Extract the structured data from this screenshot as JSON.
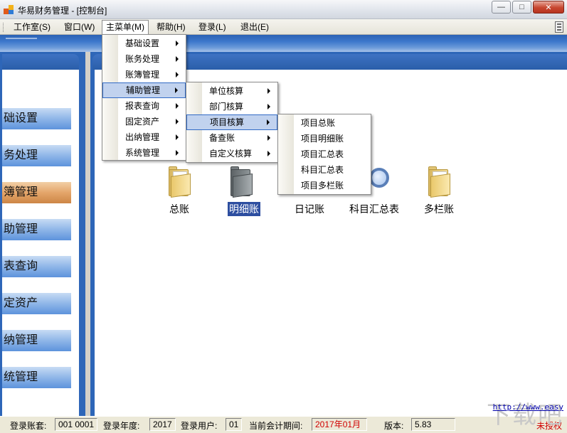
{
  "window": {
    "title": "华易财务管理 - [控制台]",
    "buttons": {
      "minimize": "—",
      "maximize": "□",
      "close": "✕"
    }
  },
  "menubar": {
    "items": [
      {
        "label": "工作室(S)"
      },
      {
        "label": "窗口(W)"
      },
      {
        "label": "主菜单(M)"
      },
      {
        "label": "帮助(H)"
      },
      {
        "label": "登录(L)"
      },
      {
        "label": "退出(E)"
      }
    ],
    "active": "主菜单(M)"
  },
  "menus": {
    "main": [
      "基础设置",
      "账务处理",
      "账簿管理",
      "辅助管理",
      "报表查询",
      "固定资产",
      "出纳管理",
      "系统管理"
    ],
    "main_highlighted": "辅助管理",
    "auxiliary": [
      "单位核算",
      "部门核算",
      "项目核算",
      "备查账",
      "自定义核算"
    ],
    "auxiliary_highlighted": "项目核算",
    "project": [
      "项目总账",
      "项目明细账",
      "项目汇总表",
      "科目汇总表",
      "项目多栏账"
    ]
  },
  "sidebar": {
    "items": [
      "础设置",
      "务处理",
      "簿管理",
      "助管理",
      "表查询",
      "定资产",
      "纳管理",
      "统管理"
    ],
    "selected": "簿管理"
  },
  "workspace": {
    "icons": [
      {
        "label": "总账",
        "icon": "folder-icon"
      },
      {
        "label": "明细账",
        "icon": "dark-folder-icon",
        "selected": true
      },
      {
        "label": "日记账",
        "icon": "folder-icon"
      },
      {
        "label": "科目汇总表",
        "icon": "magnifier-icon"
      },
      {
        "label": "多栏账",
        "icon": "folder-icon"
      }
    ]
  },
  "statusbar": {
    "account_label": "登录账套:",
    "account_value": "001 0001",
    "year_label": "登录年度:",
    "year_value": "2017",
    "user_label": "登录用户:",
    "user_value": "01",
    "period_label": "当前会计期间:",
    "period_value": "2017年01月",
    "version_label": "版本:",
    "version_value": "5.83",
    "license": "未授权"
  },
  "watermark": {
    "logo": "下载吧",
    "url": "http://www.easy"
  },
  "colors": {
    "accent_blue": "#2e66b8",
    "nav_selected": "#e4a56a",
    "status_red": "#d00000"
  }
}
